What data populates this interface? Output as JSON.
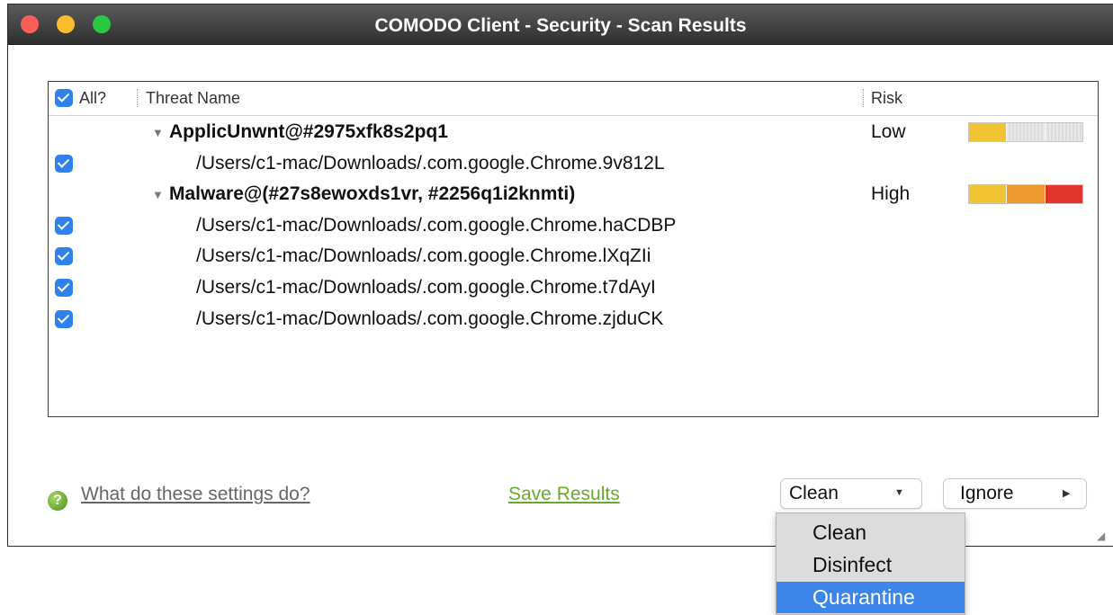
{
  "window": {
    "title": "COMODO Client - Security - Scan Results"
  },
  "table": {
    "headers": {
      "all": "All?",
      "threat_name": "Threat Name",
      "risk": "Risk"
    },
    "groups": [
      {
        "name": "ApplicUnwnt@#2975xfk8s2pq1",
        "risk": "Low",
        "risk_level_segments": 1,
        "files": [
          {
            "path": "/Users/c1-mac/Downloads/.com.google.Chrome.9v812L",
            "checked": true
          }
        ]
      },
      {
        "name": "Malware@(#27s8ewoxds1vr, #2256q1i2knmti)",
        "risk": "High",
        "risk_level_segments": 3,
        "files": [
          {
            "path": "/Users/c1-mac/Downloads/.com.google.Chrome.haCDBP",
            "checked": true
          },
          {
            "path": "/Users/c1-mac/Downloads/.com.google.Chrome.lXqZIi",
            "checked": true
          },
          {
            "path": "/Users/c1-mac/Downloads/.com.google.Chrome.t7dAyI",
            "checked": true
          },
          {
            "path": "/Users/c1-mac/Downloads/.com.google.Chrome.zjduCK",
            "checked": true
          }
        ]
      }
    ]
  },
  "footer": {
    "help_link": "What do these settings do?",
    "save_link": "Save Results",
    "action_select": "Clean",
    "ignore_button": "Ignore"
  },
  "dropdown": {
    "options": [
      "Clean",
      "Disinfect",
      "Quarantine"
    ],
    "highlighted": "Quarantine"
  },
  "colors": {
    "accent": "#2f82ee",
    "link_green": "#6aaa2a",
    "risk_yellow": "#f1c232",
    "risk_orange": "#ef9a2e",
    "risk_red": "#e0342c",
    "highlight": "#3b86e8"
  }
}
